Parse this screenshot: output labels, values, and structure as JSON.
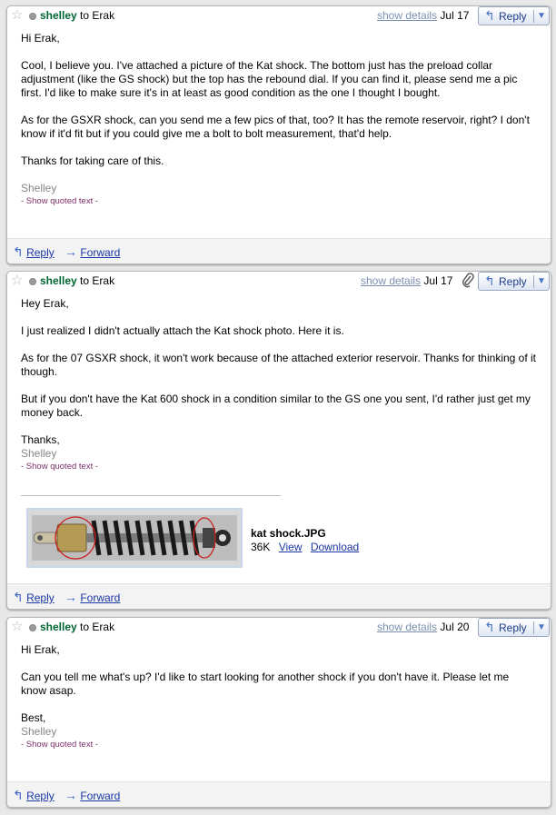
{
  "header_labels": {
    "to": "to",
    "show_details": "show details",
    "reply_button": "Reply",
    "reply_link": "Reply",
    "forward_link": "Forward"
  },
  "messages": [
    {
      "sender": "shelley",
      "recipient": "Erak",
      "date": "Jul 17",
      "has_attachment": false,
      "paragraphs": [
        "Hi Erak,",
        "Cool, I believe you. I've attached a picture of the Kat shock. The bottom just has the preload collar adjustment (like the GS shock) but the top has the rebound dial. If you can find it, please send me a pic first. I'd like to make sure it's in at least as good condition as the one I thought I bought.",
        "As for the GSXR shock, can you send me a few pics of that, too? It has the remote reservoir, right? I don't know if it'd fit but if you could give me a bolt to bolt measurement, that'd help.",
        "Thanks for taking care of this."
      ],
      "signature": "Shelley",
      "quoted": "- Show quoted text -"
    },
    {
      "sender": "shelley",
      "recipient": "Erak",
      "date": "Jul 17",
      "has_attachment": true,
      "paragraphs": [
        "Hey Erak,",
        "I just realized I didn't actually attach the Kat shock photo. Here it is.",
        "As for the 07 GSXR shock, it won't work because of the attached exterior reservoir. Thanks for thinking of it though.",
        "But if you don't have the Kat 600 shock in a condition similar to the GS one you sent, I'd rather just get my money back."
      ],
      "closing": "Thanks,",
      "signature": "Shelley",
      "quoted": "- Show quoted text -",
      "attachment": {
        "filename": "kat shock.JPG",
        "size": "36K",
        "view_label": "View",
        "download_label": "Download"
      }
    },
    {
      "sender": "shelley",
      "recipient": "Erak",
      "date": "Jul 20",
      "has_attachment": false,
      "paragraphs": [
        "Hi Erak,",
        "Can you tell me what's up? I'd like to start looking for another shock if you don't have it. Please let me know asap."
      ],
      "closing": "Best,",
      "signature": "Shelley",
      "quoted": "- Show quoted text -"
    }
  ],
  "colors": {
    "sender": "#006633",
    "link": "#1a37a6",
    "quoted": "#7b2e6a",
    "show_details": "#7a8fb0"
  },
  "icons": {
    "star": "star-icon",
    "status": "status-dot-icon",
    "reply": "reply-arrow-icon",
    "forward": "forward-arrow-icon",
    "attachment": "paperclip-icon",
    "dropdown": "chevron-down-icon"
  }
}
